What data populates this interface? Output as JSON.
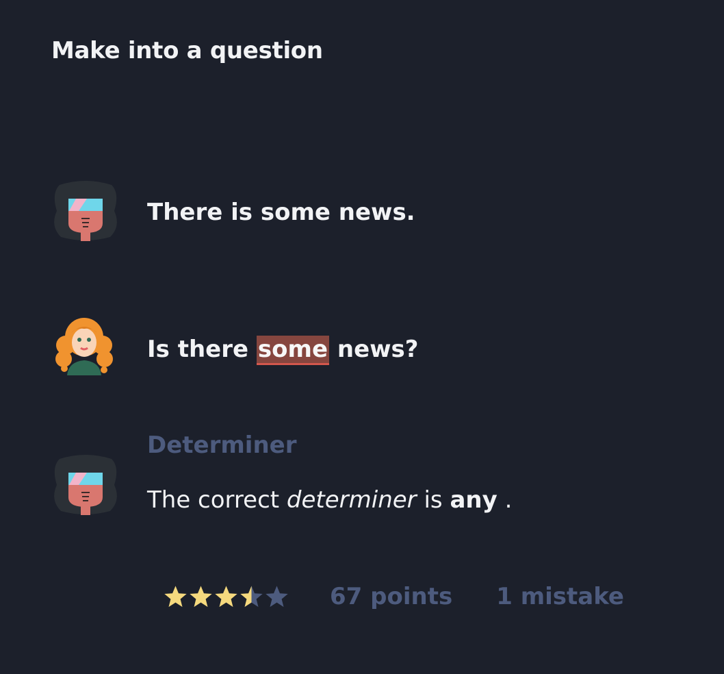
{
  "exercise": {
    "title": "Make into a question"
  },
  "conversation": {
    "prompt": {
      "avatar": "man-with-visor-icon",
      "text": "There is some news."
    },
    "answer": {
      "avatar": "woman-red-curly-hair-icon",
      "before": "Is there",
      "highlighted": "some",
      "after": "news?"
    },
    "feedback": {
      "avatar": "man-with-visor-icon",
      "heading": "Determiner",
      "text_start": "The correct",
      "term": "determiner",
      "text_mid": "is",
      "correct_word": "any",
      "text_end": "."
    }
  },
  "result": {
    "rating": 3.5,
    "rating_max": 5,
    "points_label": "67 points",
    "mistakes_label": "1 mistake"
  },
  "colors": {
    "background": "#1c202b",
    "text": "#f2f3f5",
    "muted": "#4d5b7e",
    "highlight": "#86463f",
    "highlight_underline": "#d2574d",
    "star_filled": "#f5d97e",
    "star_empty": "#4d5b7e"
  }
}
